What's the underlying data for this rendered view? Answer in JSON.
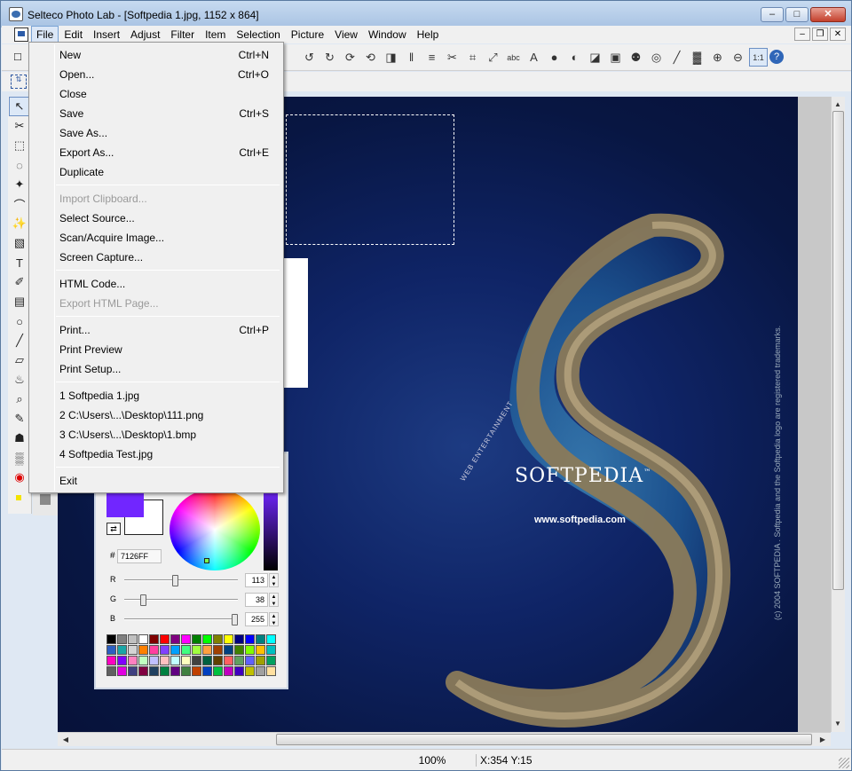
{
  "window": {
    "title": "Selteco Photo Lab - [Softpedia 1.jpg, 1152 x 864]",
    "minimize": "–",
    "maximize": "□",
    "close": "✕"
  },
  "menubar": {
    "items": [
      "File",
      "Edit",
      "Insert",
      "Adjust",
      "Filter",
      "Item",
      "Selection",
      "Picture",
      "View",
      "Window",
      "Help"
    ],
    "mdi_minimize": "–",
    "mdi_restore": "❐",
    "mdi_close": "✕"
  },
  "file_menu": {
    "groups": [
      [
        {
          "label": "New",
          "shortcut": "Ctrl+N",
          "enabled": true
        },
        {
          "label": "Open...",
          "shortcut": "Ctrl+O",
          "enabled": true
        },
        {
          "label": "Close",
          "shortcut": "",
          "enabled": true
        },
        {
          "label": "Save",
          "shortcut": "Ctrl+S",
          "enabled": true
        },
        {
          "label": "Save As...",
          "shortcut": "",
          "enabled": true
        },
        {
          "label": "Export As...",
          "shortcut": "Ctrl+E",
          "enabled": true
        },
        {
          "label": "Duplicate",
          "shortcut": "",
          "enabled": true
        }
      ],
      [
        {
          "label": "Import Clipboard...",
          "shortcut": "",
          "enabled": false
        },
        {
          "label": "Select Source...",
          "shortcut": "",
          "enabled": true
        },
        {
          "label": "Scan/Acquire Image...",
          "shortcut": "",
          "enabled": true
        },
        {
          "label": "Screen Capture...",
          "shortcut": "",
          "enabled": true
        }
      ],
      [
        {
          "label": "HTML Code...",
          "shortcut": "",
          "enabled": true
        },
        {
          "label": "Export HTML Page...",
          "shortcut": "",
          "enabled": false
        }
      ],
      [
        {
          "label": "Print...",
          "shortcut": "Ctrl+P",
          "enabled": true
        },
        {
          "label": "Print Preview",
          "shortcut": "",
          "enabled": true
        },
        {
          "label": "Print Setup...",
          "shortcut": "",
          "enabled": true
        }
      ],
      [
        {
          "label": "1 Softpedia 1.jpg",
          "shortcut": "",
          "enabled": true
        },
        {
          "label": "2 C:\\Users\\...\\Desktop\\111.png",
          "shortcut": "",
          "enabled": true
        },
        {
          "label": "3 C:\\Users\\...\\Desktop\\1.bmp",
          "shortcut": "",
          "enabled": true
        },
        {
          "label": "4 Softpedia Test.jpg",
          "shortcut": "",
          "enabled": true
        }
      ],
      [
        {
          "label": "Exit",
          "shortcut": "",
          "enabled": true
        }
      ]
    ]
  },
  "toolbar": {
    "icons": [
      "rotate-left-icon",
      "rotate-right-icon",
      "rotate-icon",
      "rotate-ccw-icon",
      "flip-icon",
      "mirror-icon",
      "align-icon",
      "cut-icon",
      "crop-icon",
      "resize-icon",
      "text-abc-icon",
      "text-a-icon",
      "circle-icon",
      "contrast-icon",
      "exposure-icon",
      "image-icon",
      "rgb-icon",
      "color-wheel-icon",
      "pen-icon",
      "spectrum-icon",
      "zoom-in-icon",
      "zoom-out-icon",
      "zoom-actual-icon",
      "help-icon"
    ],
    "glyphs": [
      "↺",
      "↻",
      "⟳",
      "⟲",
      "◨",
      "‖",
      "≡",
      "✂",
      "⌗",
      "⤢",
      "abc",
      "A",
      "●",
      "◐",
      "◪",
      "▣",
      "⚉",
      "◎",
      "╱",
      "▓",
      "⊕",
      "⊖",
      "1:1",
      "?"
    ]
  },
  "tools": {
    "icons": [
      "arrow-icon",
      "scissors-icon",
      "rect-select-icon",
      "ellipse-select-icon",
      "lasso-icon",
      "freeform-lasso-icon",
      "magic-wand-icon",
      "fill-icon",
      "text-tool-icon",
      "eyedropper-icon",
      "gradient-icon",
      "shape-icon",
      "line-icon",
      "eraser-icon",
      "bucket-icon",
      "magnify-icon",
      "brush-icon",
      "stamp-icon",
      "ruler-icon",
      "red-eye-icon"
    ],
    "glyphs": [
      "↖",
      "✂",
      "⬚",
      "◌",
      "✦",
      "⌒",
      "✨",
      "▧",
      "T",
      "✐",
      "▤",
      "○",
      "╱",
      "▱",
      "♨",
      "⌕",
      "✎",
      "☗",
      "▒",
      "◉"
    ]
  },
  "canvas": {
    "brand": "SOFTPEDIA",
    "trademark": "™",
    "url": "www.softpedia.com",
    "web_text": "WEB ENTERTAINMENT",
    "copyright": "(c) 2004 SOFTPEDIA . Softpedia and the Softpedia logo are registered trademarks."
  },
  "color_panel": {
    "foreground": "#7126FF",
    "background": "#FFFFFF",
    "hash": "#",
    "hex_value": "7126FF",
    "sliders": [
      {
        "label": "R",
        "value": "113",
        "fraction": 0.443
      },
      {
        "label": "G",
        "value": "38",
        "fraction": 0.149
      },
      {
        "label": "B",
        "value": "255",
        "fraction": 1.0
      }
    ],
    "palette": [
      "#000000",
      "#808080",
      "#c0c0c0",
      "#ffffff",
      "#800000",
      "#ff0000",
      "#800080",
      "#ff00ff",
      "#008000",
      "#00ff00",
      "#808000",
      "#ffff00",
      "#000080",
      "#0000ff",
      "#008080",
      "#00ffff",
      "#2c5fc1",
      "#1aa6a6",
      "#d4d4d4",
      "#ff8000",
      "#ff40a0",
      "#8040ff",
      "#00a0ff",
      "#40ff80",
      "#a0ff40",
      "#ffa040",
      "#a04000",
      "#004080",
      "#408000",
      "#80ff00",
      "#ffc000",
      "#00c0c0",
      "#ff00c0",
      "#8000ff",
      "#ff80c0",
      "#c0ffc0",
      "#c0c0ff",
      "#ffc0c0",
      "#c0ffff",
      "#ffffc0",
      "#404040",
      "#006040",
      "#604000",
      "#ff6060",
      "#60a060",
      "#6060ff",
      "#a0a000",
      "#00a060",
      "#606060",
      "#e000e0",
      "#404080",
      "#800040",
      "#204060",
      "#008040",
      "#600080",
      "#408040",
      "#c04000",
      "#0040c0",
      "#00c040",
      "#c000c0",
      "#4000c0",
      "#c0c000",
      "#a0a0a0",
      "#ffe0a0"
    ]
  },
  "status": {
    "zoom": "100%",
    "coords": "X:354  Y:15"
  }
}
